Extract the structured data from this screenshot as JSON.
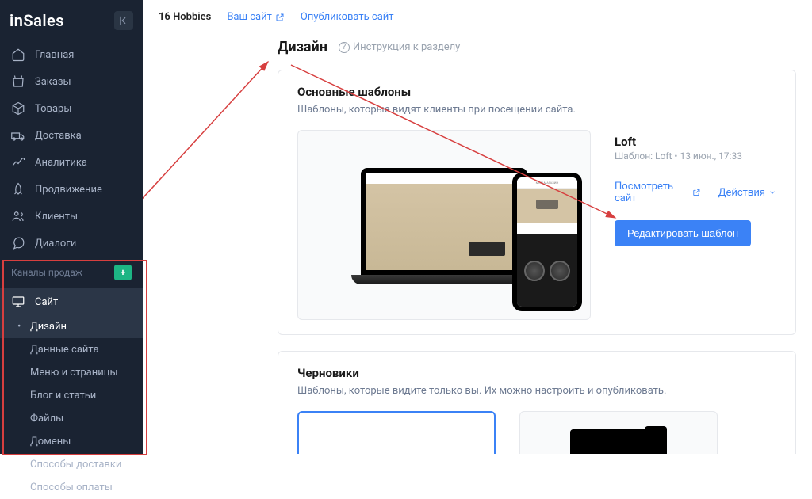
{
  "logo": "inSales",
  "nav": [
    {
      "label": "Главная",
      "name": "home"
    },
    {
      "label": "Заказы",
      "name": "orders"
    },
    {
      "label": "Товары",
      "name": "products"
    },
    {
      "label": "Доставка",
      "name": "delivery"
    },
    {
      "label": "Аналитика",
      "name": "analytics"
    },
    {
      "label": "Продвижение",
      "name": "promotion"
    },
    {
      "label": "Клиенты",
      "name": "clients"
    },
    {
      "label": "Диалоги",
      "name": "dialogs"
    }
  ],
  "channels_label": "Каналы продаж",
  "site_nav": {
    "head": "Сайт",
    "items": [
      {
        "label": "Дизайн",
        "active": true
      },
      {
        "label": "Данные сайта"
      },
      {
        "label": "Меню и страницы"
      },
      {
        "label": "Блог и статьи"
      },
      {
        "label": "Файлы"
      },
      {
        "label": "Домены"
      },
      {
        "label": "Способы доставки"
      },
      {
        "label": "Способы оплаты"
      }
    ]
  },
  "topbar": {
    "store": "16 Hobbies",
    "your_site": "Ваш сайт",
    "publish": "Опубликовать сайт"
  },
  "page": {
    "title": "Дизайн",
    "help": "Инструкция к разделу"
  },
  "main_templates": {
    "title": "Основные шаблоны",
    "desc": "Шаблоны, которые видят клиенты при посещении сайта.",
    "template": {
      "name": "Loft",
      "sub": "Шаблон: Loft • 13 июн., 17:33",
      "view_site": "Посмотреть сайт",
      "actions": "Действия",
      "edit": "Редактировать шаблон"
    }
  },
  "phone_title": "МОЙ МАГАЗИН",
  "drafts": {
    "title": "Черновики",
    "desc": "Шаблоны, которые видите только вы. Их можно настроить и опубликовать."
  }
}
